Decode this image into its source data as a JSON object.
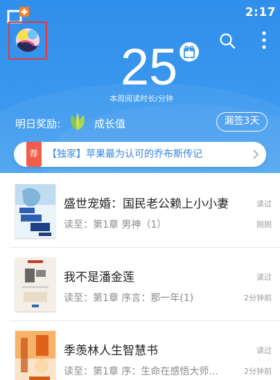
{
  "status_bar": {
    "time": "2:17"
  },
  "header": {
    "weekly_minutes": "25",
    "weekly_caption": "本周阅读时长/分钟",
    "reward_label": "明日奖励:",
    "reward_value": "成长值",
    "signin_label": "漏签3天"
  },
  "promo": {
    "badge": "荐",
    "text": "【独家】苹果最为认可的乔布斯传记"
  },
  "books": [
    {
      "title": "盛世宠婚：国民老公赖上小小妻",
      "progress": "读至：第1章 男神（1）",
      "status": "读过",
      "time": "刚刚"
    },
    {
      "title": "我不是潘金莲",
      "progress": "读至：第1章 序言：那一年(1)",
      "status": "读过",
      "time": "2分钟前"
    },
    {
      "title": "季羡林人生智慧书",
      "progress": "读至：第1章 序：生命在感悟大师...",
      "status": "读过",
      "time": "2分钟前"
    }
  ],
  "colors": {
    "header_blue": "#3b98ee",
    "highlight_border": "#e53935",
    "promo_badge": "#f25d4a",
    "promo_text": "#2b7fe0"
  },
  "icons": [
    "add-to-shelf-icon",
    "search-icon",
    "more-vertical-icon",
    "gift-icon",
    "leaf-icon",
    "chevron-right-icon"
  ]
}
